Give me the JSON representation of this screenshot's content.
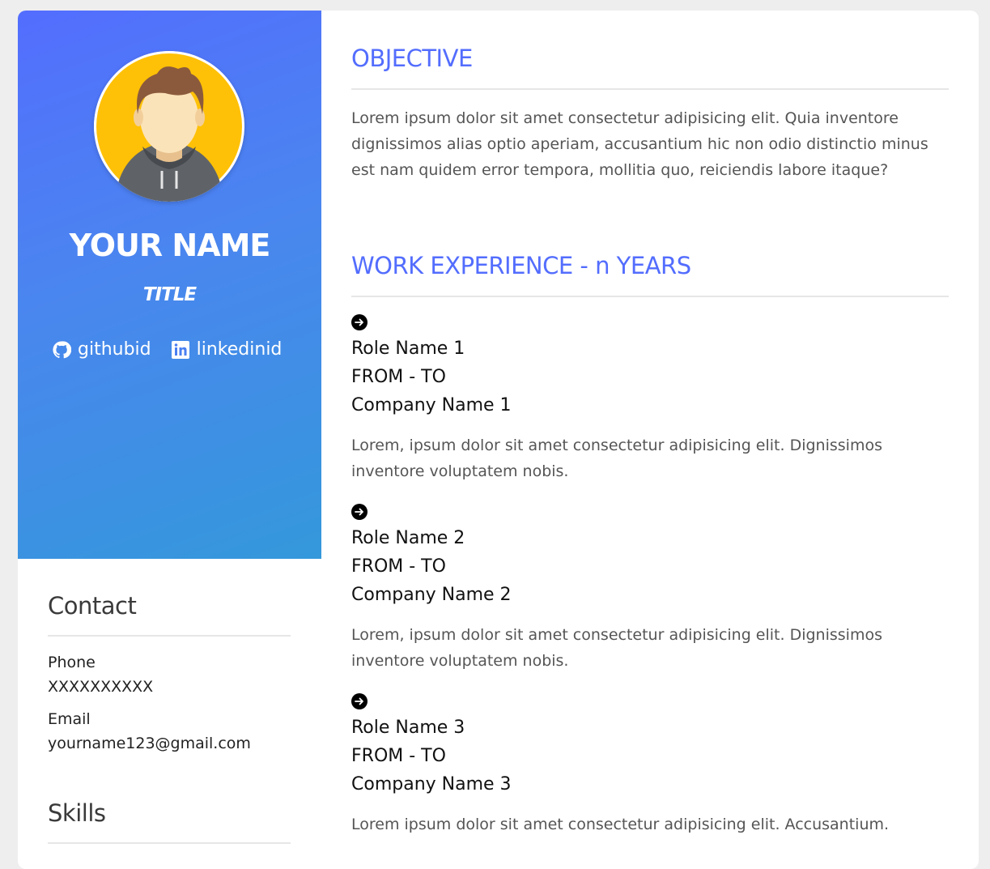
{
  "profile": {
    "name": "YOUR NAME",
    "title": "TITLE",
    "github": "githubid",
    "linkedin": "linkedinid"
  },
  "contact": {
    "heading": "Contact",
    "phone_label": "Phone",
    "phone_value": "XXXXXXXXXX",
    "email_label": "Email",
    "email_value": "yourname123@gmail.com"
  },
  "skills": {
    "heading": "Skills"
  },
  "objective": {
    "heading": "OBJECTIVE",
    "text": "Lorem ipsum dolor sit amet consectetur adipisicing elit. Quia inventore dignissimos alias optio aperiam, accusantium hic non odio distinctio minus est nam quidem error tempora, mollitia quo, reiciendis labore itaque?"
  },
  "experience": {
    "heading": "WORK EXPERIENCE - n YEARS",
    "jobs": [
      {
        "role": "Role Name 1",
        "period": "FROM - TO",
        "company": "Company Name 1",
        "description": "Lorem, ipsum dolor sit amet consectetur adipisicing elit. Dignissimos inventore voluptatem nobis."
      },
      {
        "role": "Role Name 2",
        "period": "FROM - TO",
        "company": "Company Name 2",
        "description": "Lorem, ipsum dolor sit amet consectetur adipisicing elit. Dignissimos inventore voluptatem nobis."
      },
      {
        "role": "Role Name 3",
        "period": "FROM - TO",
        "company": "Company Name 3",
        "description": "Lorem ipsum dolor sit amet consectetur adipisicing elit. Accusantium."
      }
    ]
  },
  "icons": {
    "avatar": "avatar-icon",
    "github": "github-icon",
    "linkedin": "linkedin-icon",
    "bullet": "arrow-right-circle-icon"
  },
  "colors": {
    "accent": "#536dfe",
    "gradient_start": "#536dfe",
    "gradient_end": "#3498db"
  }
}
